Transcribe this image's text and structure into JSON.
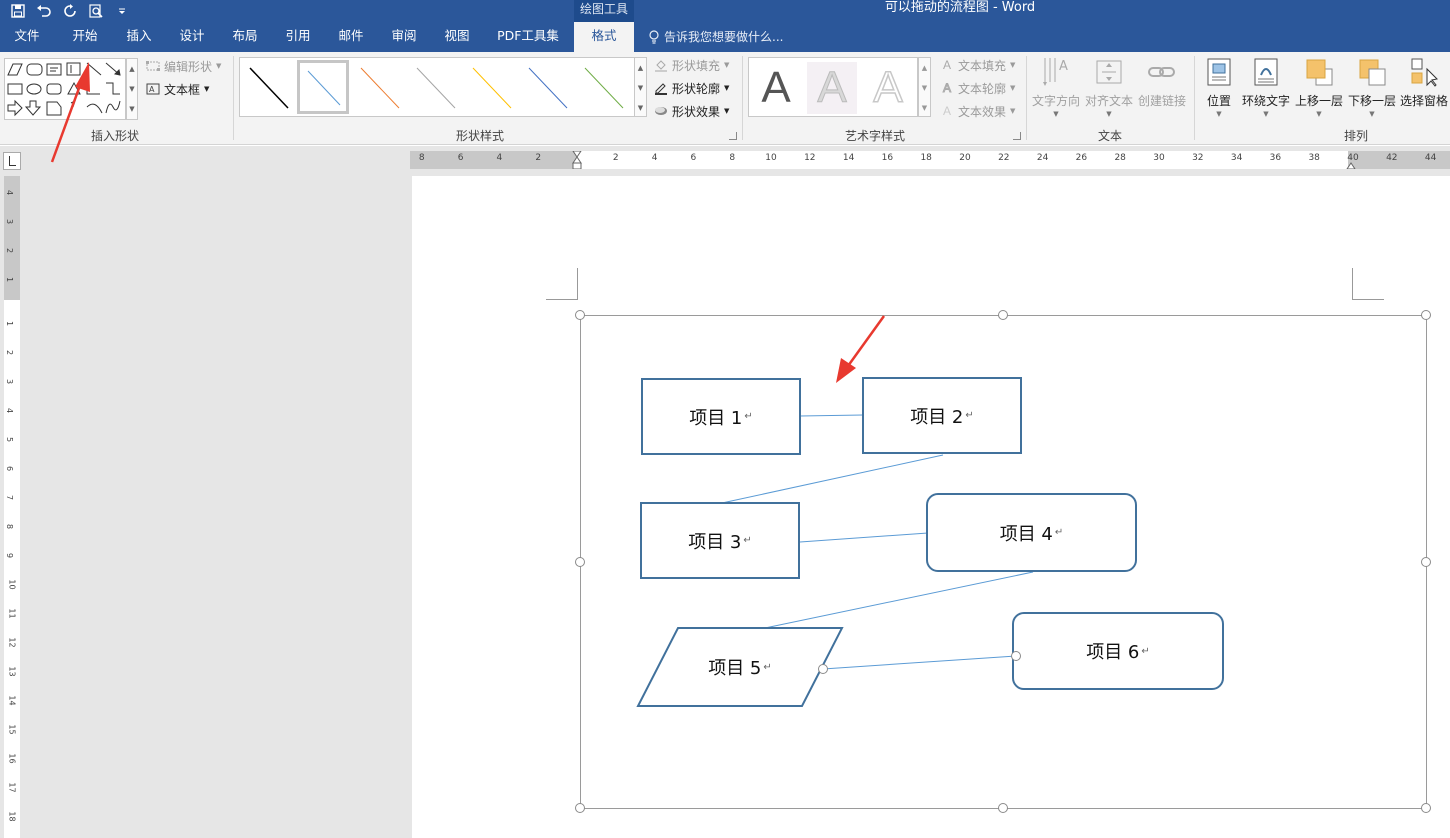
{
  "titlebar": {
    "context_tab": "绘图工具",
    "title": "可以拖动的流程图 - Word",
    "qat_icons": [
      "save-icon",
      "undo-icon",
      "redo-icon",
      "print-preview-icon",
      "customize-icon"
    ]
  },
  "tabs": [
    {
      "label": "文件"
    },
    {
      "label": "开始"
    },
    {
      "label": "插入"
    },
    {
      "label": "设计"
    },
    {
      "label": "布局"
    },
    {
      "label": "引用"
    },
    {
      "label": "邮件"
    },
    {
      "label": "审阅"
    },
    {
      "label": "视图"
    },
    {
      "label": "PDF工具集"
    },
    {
      "label": "格式",
      "active": true
    }
  ],
  "tell_me": "告诉我您想要做什么...",
  "ribbon": {
    "insert_shapes": {
      "label": "插入形状",
      "edit_shape": "编辑形状",
      "text_box": "文本框"
    },
    "shape_styles": {
      "label": "形状样式",
      "fill": "形状填充",
      "outline": "形状轮廓",
      "effects": "形状效果",
      "swatch_colors": [
        "#000000",
        "#5b9bd5",
        "#ed7d31",
        "#a5a5a5",
        "#ffc000",
        "#4472c4",
        "#70ad47"
      ]
    },
    "wordart": {
      "label": "艺术字样式",
      "glyph": "A",
      "text_fill": "文本填充",
      "text_outline": "文本轮廓",
      "text_effects": "文本效果"
    },
    "text": {
      "label": "文本",
      "direction": "文字方向",
      "align": "对齐文本",
      "link": "创建链接"
    },
    "arrange": {
      "label": "排列",
      "position": "位置",
      "wrap": "环绕文字",
      "forward": "上移一层",
      "backward": "下移一层",
      "selection_pane": "选择窗格"
    }
  },
  "ruler": {
    "h_left": [
      "8",
      "6",
      "4",
      "2"
    ],
    "h_right": [
      "2",
      "4",
      "6",
      "8",
      "10",
      "12",
      "14",
      "16",
      "18",
      "20",
      "22",
      "24",
      "26",
      "28",
      "30",
      "32",
      "34",
      "36",
      "38",
      "40",
      "42",
      "44"
    ],
    "v_top": [
      "4",
      "3",
      "2",
      "1"
    ],
    "v_bottom": [
      "1",
      "2",
      "3",
      "4",
      "5",
      "6",
      "7",
      "8",
      "9",
      "10",
      "11",
      "12",
      "13",
      "14",
      "15",
      "16",
      "17",
      "18"
    ]
  },
  "flowchart": {
    "nodes": [
      {
        "id": "n1",
        "label": "项目 1",
        "shape": "rect"
      },
      {
        "id": "n2",
        "label": "项目 2",
        "shape": "rect"
      },
      {
        "id": "n3",
        "label": "项目 3",
        "shape": "rect"
      },
      {
        "id": "n4",
        "label": "项目 4",
        "shape": "rounded"
      },
      {
        "id": "n5",
        "label": "项目 5",
        "shape": "parallelogram"
      },
      {
        "id": "n6",
        "label": "项目 6",
        "shape": "rounded"
      }
    ],
    "connectors": [
      [
        "n1",
        "n2"
      ],
      [
        "n2",
        "n3"
      ],
      [
        "n3",
        "n4"
      ],
      [
        "n4",
        "n5"
      ],
      [
        "n5",
        "n6"
      ]
    ],
    "paragraph_mark": "↵",
    "border_color": "#41719c",
    "connector_color": "#5b9bd5"
  },
  "annotation_color": "#e8392f"
}
